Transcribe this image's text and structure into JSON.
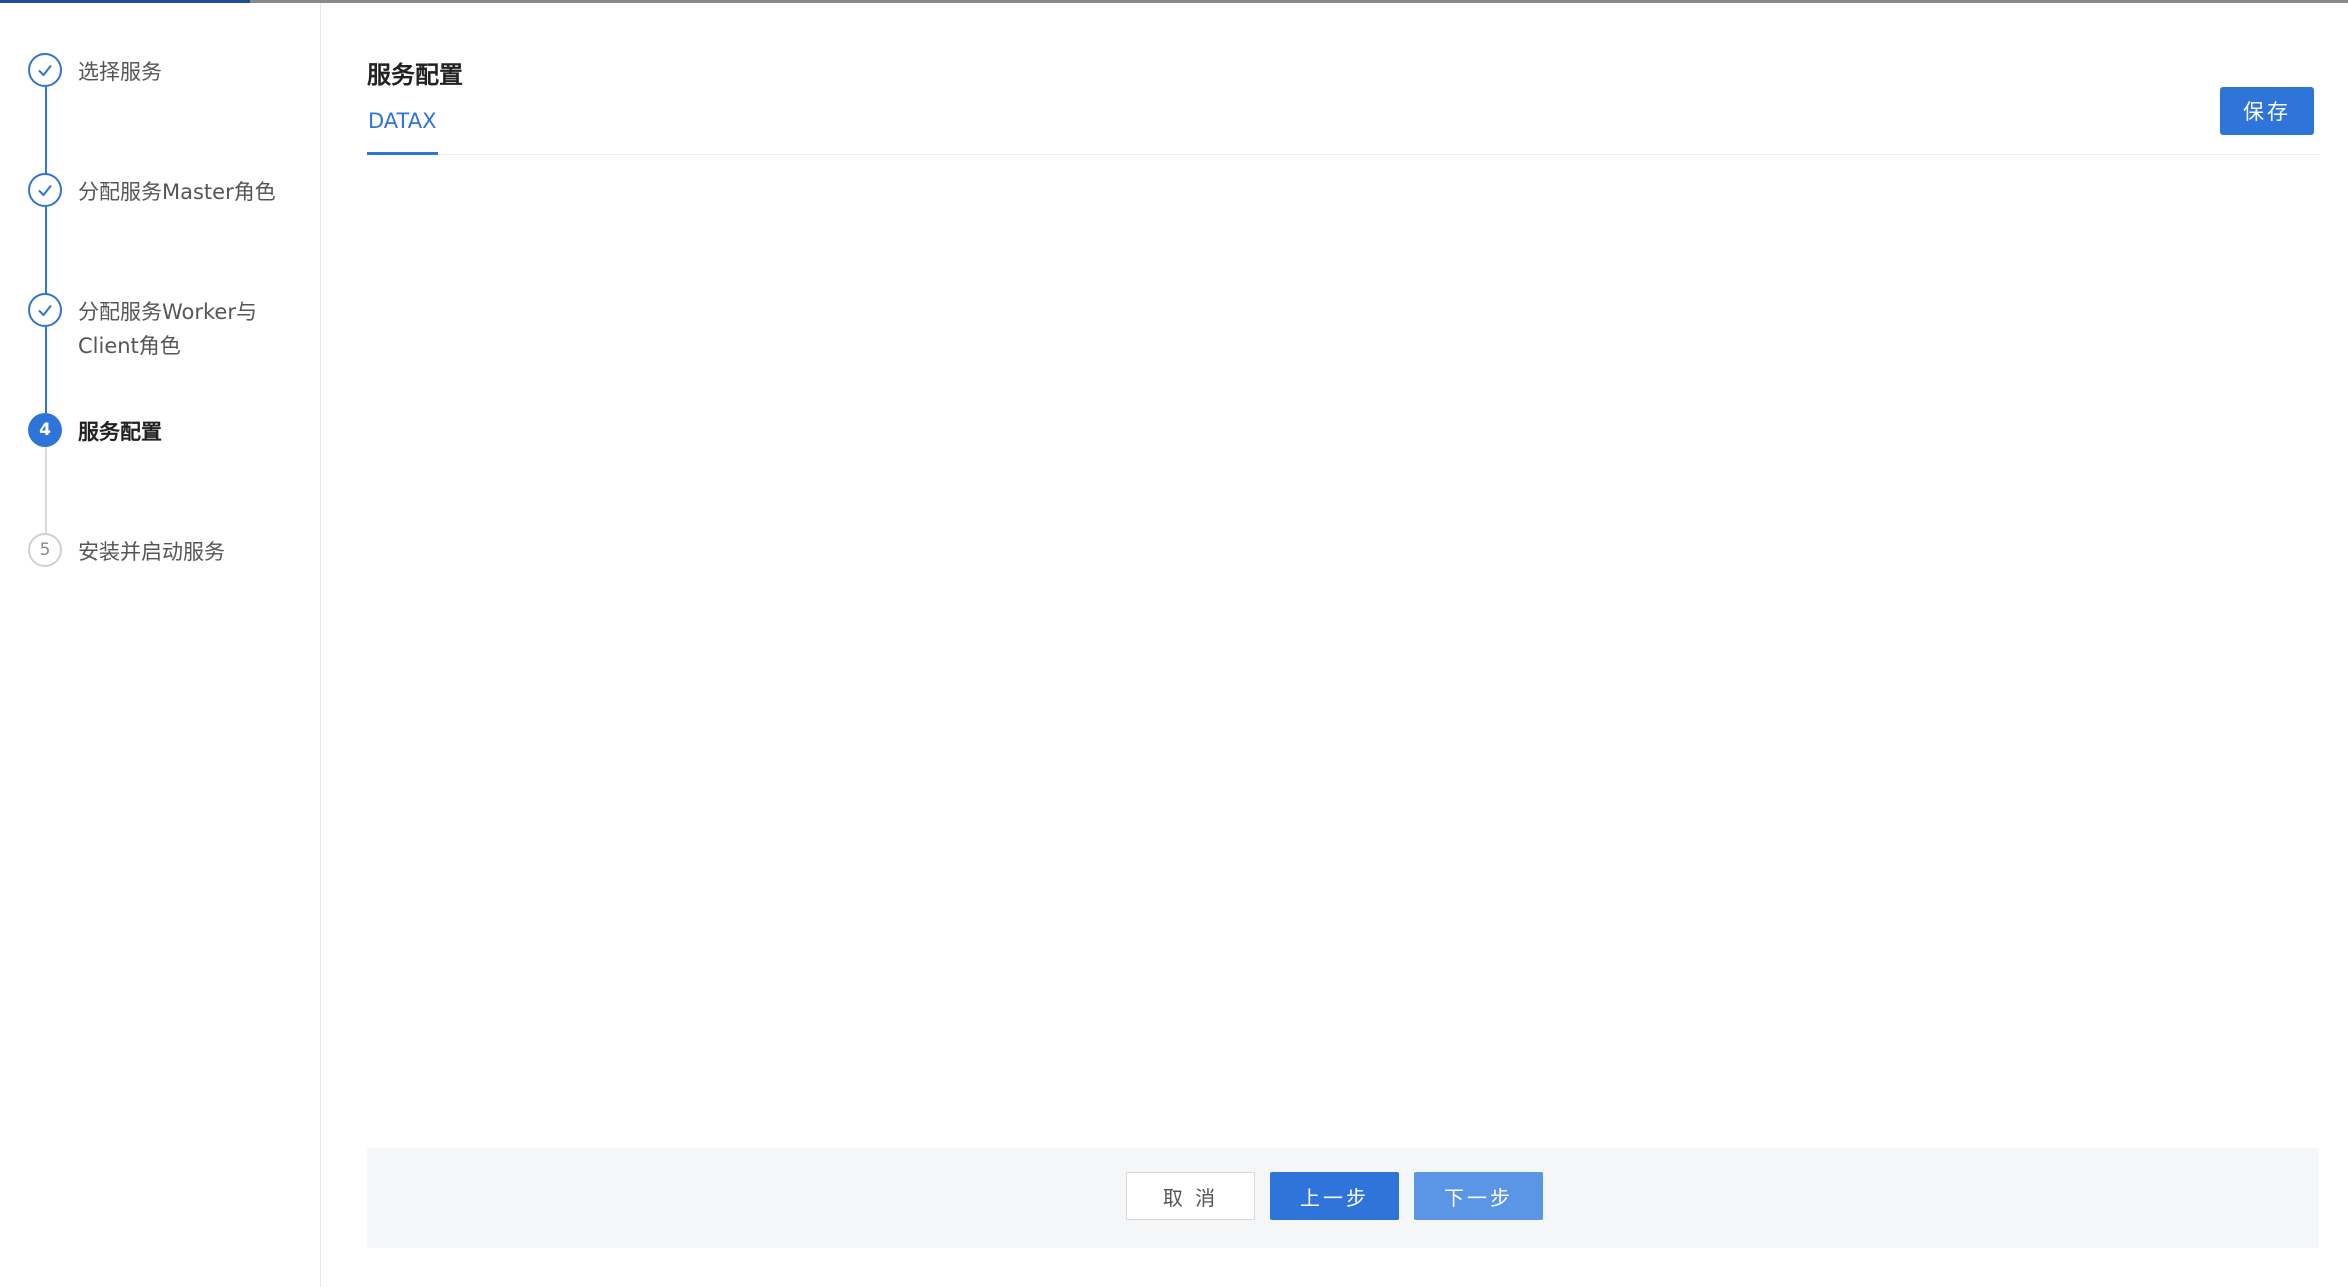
{
  "steps": [
    {
      "label": "选择服务",
      "state": "done",
      "icon": "check-icon"
    },
    {
      "label": "分配服务Master角色",
      "state": "done",
      "icon": "check-icon"
    },
    {
      "label": "分配服务Worker与Client角色",
      "state": "done",
      "icon": "check-icon"
    },
    {
      "label": "服务配置",
      "state": "active",
      "number": "4"
    },
    {
      "label": "安装并启动服务",
      "state": "todo",
      "number": "5"
    }
  ],
  "main": {
    "title": "服务配置",
    "tabs": [
      {
        "label": "DATAX",
        "active": true
      }
    ],
    "save_label": "保存"
  },
  "footer": {
    "cancel_label": "取 消",
    "prev_label": "上一步",
    "next_label": "下一步"
  },
  "colors": {
    "accent": "#2f74d8",
    "next_button": "#5a95e6",
    "footer_bg": "#f5f6f8"
  }
}
